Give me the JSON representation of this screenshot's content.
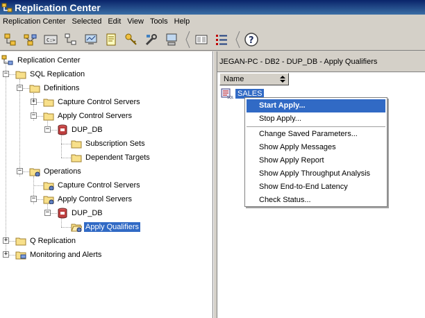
{
  "window": {
    "title": "Replication Center"
  },
  "menu": [
    "Replication Center",
    "Selected",
    "Edit",
    "View",
    "Tools",
    "Help"
  ],
  "toolbar": {
    "icons": [
      "tree-icon",
      "network-icon",
      "console-icon",
      "launchpad-icon",
      "monitor-icon",
      "note-icon",
      "key-icon",
      "tools-icon",
      "computer-icon",
      "grid-icon",
      "list-icon",
      "help-icon"
    ]
  },
  "tree": {
    "root": "Replication Center",
    "sql_replication": "SQL Replication",
    "definitions": "Definitions",
    "def_capture": "Capture Control Servers",
    "def_apply": "Apply Control Servers",
    "def_dup_db": "DUP_DB",
    "subscription_sets": "Subscription Sets",
    "dependent_targets": "Dependent Targets",
    "operations": "Operations",
    "op_capture": "Capture Control Servers",
    "op_apply": "Apply Control Servers",
    "op_dup_db": "DUP_DB",
    "apply_qualifiers": "Apply Qualifiers",
    "q_replication": "Q Replication",
    "monitoring": "Monitoring and Alerts"
  },
  "right_pane": {
    "path": "JEGAN-PC - DB2 - DUP_DB - Apply Qualifiers",
    "column_name": "Name",
    "rows": [
      "SALES"
    ]
  },
  "context_menu": {
    "items": [
      "Start Apply...",
      "Stop Apply...",
      "Change Saved Parameters...",
      "Show Apply Messages",
      "Show Apply Report",
      "Show Apply Throughput Analysis",
      "Show End-to-End Latency",
      "Check Status..."
    ]
  },
  "colors": {
    "selection": "#316ac5",
    "titlebar": "#0a246a",
    "chrome": "#d4d0c8"
  }
}
